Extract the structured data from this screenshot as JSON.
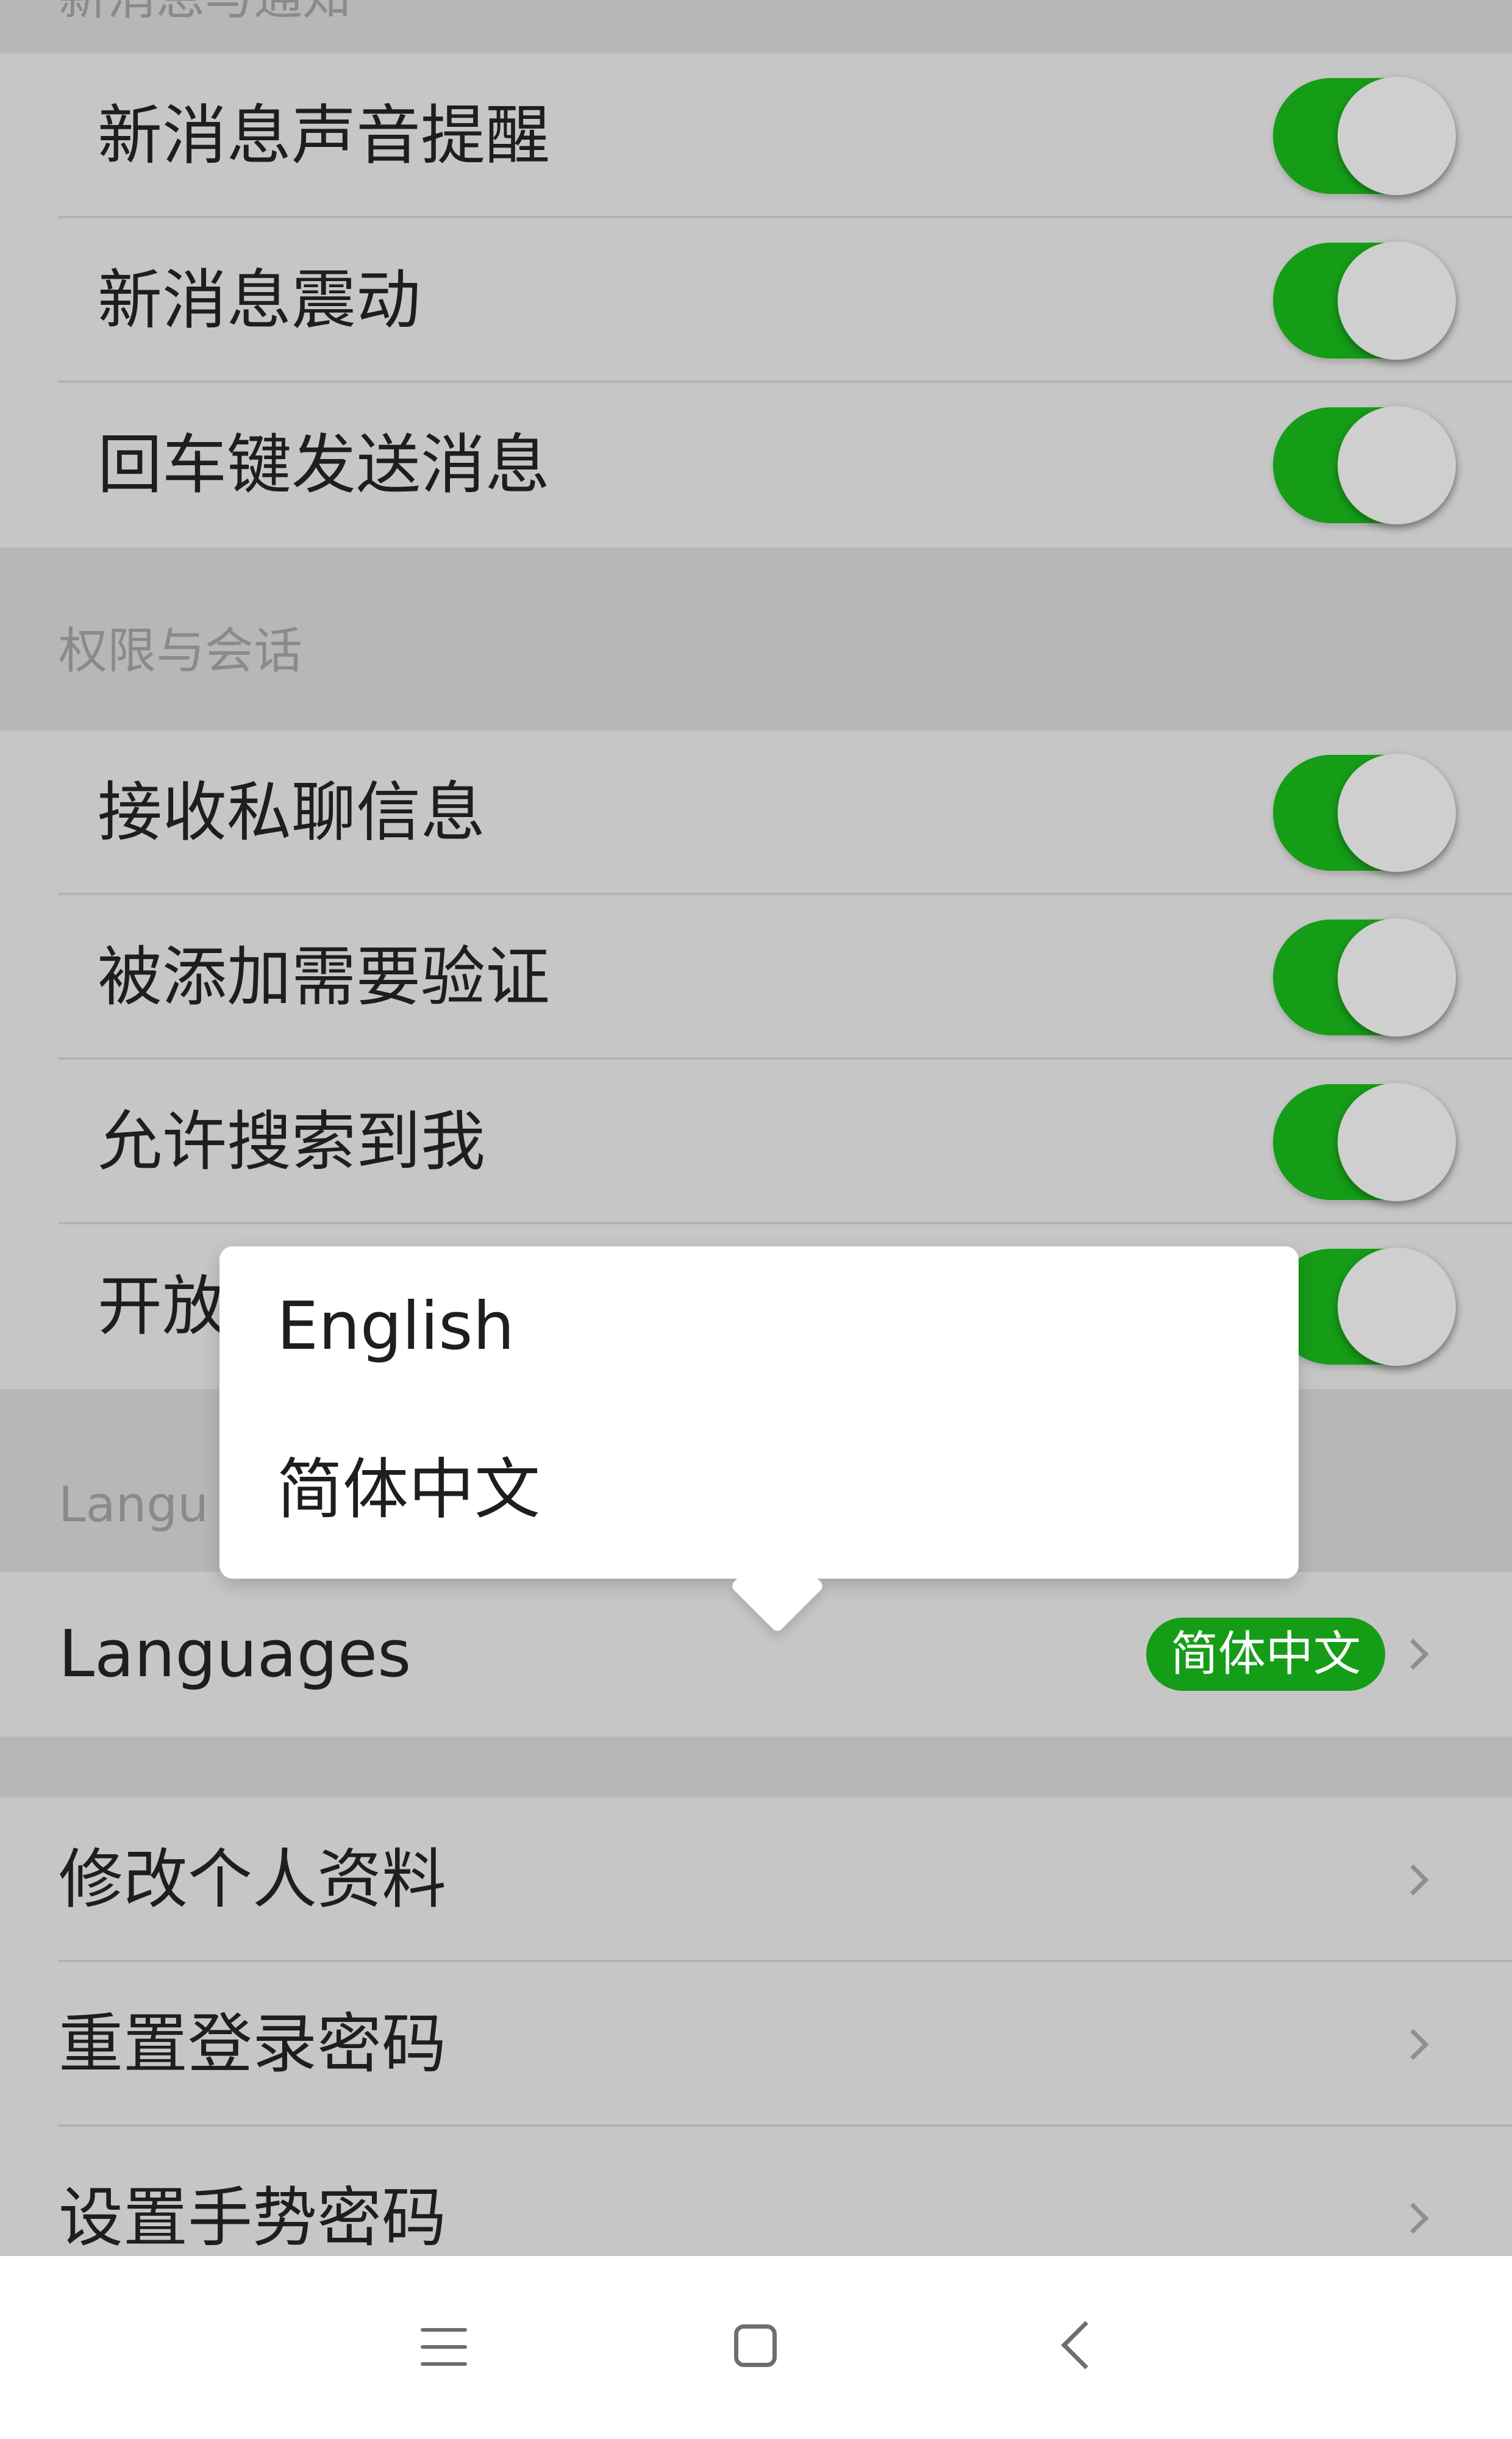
{
  "colors": {
    "accent_green": "#159d17",
    "page_bg": "#c6c6c6",
    "section_bg": "#b7b7b7"
  },
  "section_top": {
    "partial_header": "新消息与通知"
  },
  "notifications": [
    {
      "label": "新消息声音提醒",
      "enabled": true
    },
    {
      "label": "新消息震动",
      "enabled": true
    },
    {
      "label": "回车键发送消息",
      "enabled": true
    }
  ],
  "permissions_header": "权限与会话",
  "permissions": [
    {
      "label": "接收私聊信息",
      "enabled": true
    },
    {
      "label": "被添加需要验证",
      "enabled": true
    },
    {
      "label": "允许搜索到我",
      "enabled": true
    },
    {
      "label": "开放",
      "enabled": true
    }
  ],
  "language_header": "Langu",
  "language_row": {
    "label": "Languages",
    "value": "简体中文"
  },
  "account": [
    {
      "label": "修改个人资料"
    },
    {
      "label": "重置登录密码"
    },
    {
      "label": "设置手势密码"
    }
  ],
  "popup": {
    "options": [
      "English",
      "简体中文"
    ]
  },
  "navbar": {
    "icons": [
      "menu-icon",
      "home-icon",
      "back-icon"
    ]
  }
}
